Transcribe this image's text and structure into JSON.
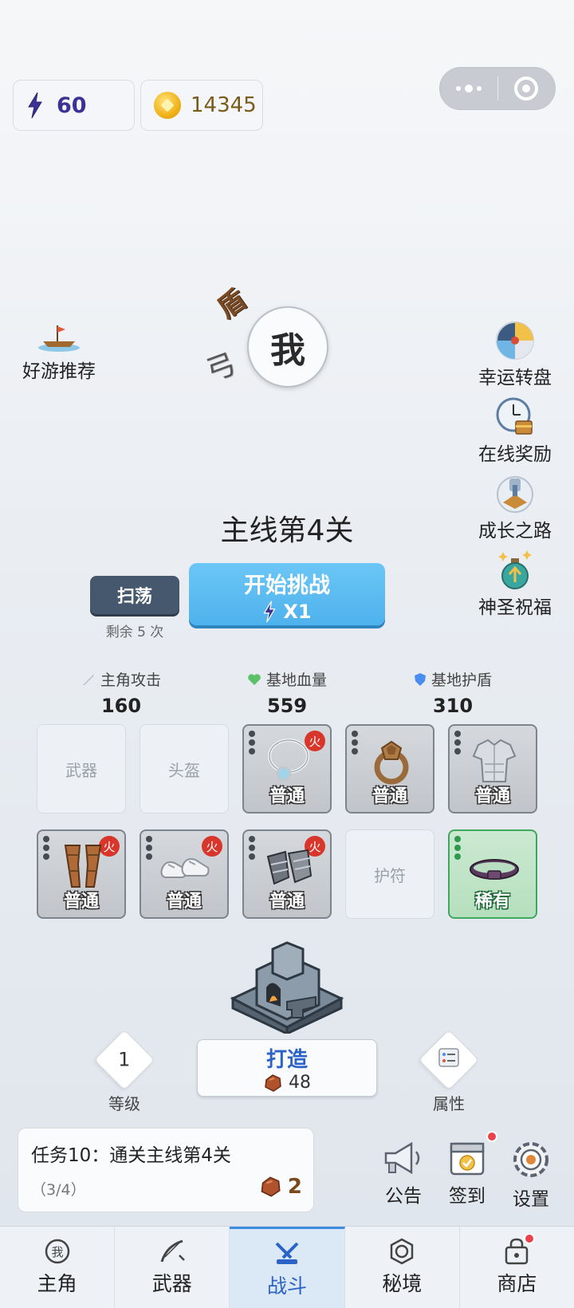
{
  "resources": {
    "energy": "60",
    "coins": "14345"
  },
  "side_left": {
    "recommend_label": "好游推荐"
  },
  "side_right": [
    {
      "label": "幸运转盘",
      "icon": "lucky-wheel-icon"
    },
    {
      "label": "在线奖励",
      "icon": "clock-chest-icon"
    },
    {
      "label": "成长之路",
      "icon": "growth-road-icon"
    },
    {
      "label": "神圣祝福",
      "icon": "holy-potion-icon"
    }
  ],
  "hero": {
    "label": "我",
    "orbit_items": [
      "盾",
      "弓"
    ]
  },
  "level": {
    "title": "主线第4关"
  },
  "sweep": {
    "label": "扫荡",
    "remaining": "剩余 5 次"
  },
  "challenge": {
    "label": "开始挑战",
    "cost": "X1"
  },
  "stats": [
    {
      "label": "主角攻击",
      "value": "160",
      "icon": "sword-icon"
    },
    {
      "label": "基地血量",
      "value": "559",
      "icon": "heart-icon"
    },
    {
      "label": "基地护盾",
      "value": "310",
      "icon": "shield-icon"
    }
  ],
  "slots": [
    {
      "empty_label": "武器"
    },
    {
      "empty_label": "头盔"
    },
    {
      "quality": "普通",
      "fire": "火",
      "item": "necklace"
    },
    {
      "quality": "普通",
      "fire": "",
      "item": "ring"
    },
    {
      "quality": "普通",
      "fire": "",
      "item": "armor"
    },
    {
      "quality": "普通",
      "fire": "火",
      "item": "leggings"
    },
    {
      "quality": "普通",
      "fire": "火",
      "item": "shoes"
    },
    {
      "quality": "普通",
      "fire": "火",
      "item": "gauntlets"
    },
    {
      "empty_label": "护符"
    },
    {
      "quality": "稀有",
      "fire": "",
      "item": "belt"
    }
  ],
  "forge": {
    "level_value": "1",
    "level_label": "等级",
    "attr_label": "属性",
    "button_label": "打造",
    "cost": "48"
  },
  "task": {
    "title": "任务10：通关主线第4关",
    "progress": "（3/4）",
    "reward": "2"
  },
  "utilities": {
    "notice": "公告",
    "signin": "签到",
    "settings": "设置"
  },
  "nav": [
    {
      "label": "主角",
      "icon": "hero-icon"
    },
    {
      "label": "武器",
      "icon": "weapon-icon"
    },
    {
      "label": "战斗",
      "icon": "battle-icon"
    },
    {
      "label": "秘境",
      "icon": "secret-realm-icon"
    },
    {
      "label": "商店",
      "icon": "shop-icon"
    }
  ],
  "colors": {
    "accent": "#4eb2ec",
    "active_nav": "#2b63c8",
    "energy": "#3c3296",
    "red_badge": "#e8434b"
  }
}
